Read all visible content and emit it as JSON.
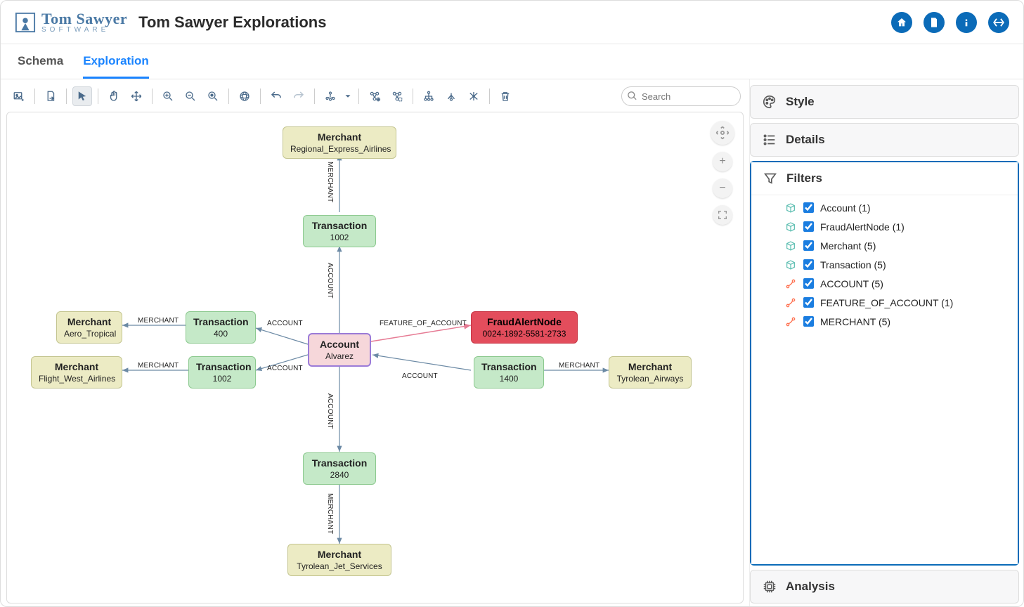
{
  "header": {
    "logo_top": "Tom Sawyer",
    "logo_bottom": "SOFTWARE",
    "app_title": "Tom Sawyer Explorations"
  },
  "tabs": {
    "schema": "Schema",
    "exploration": "Exploration"
  },
  "search": {
    "placeholder": "Search"
  },
  "right_panel": {
    "style": "Style",
    "details": "Details",
    "filters": "Filters",
    "analysis": "Analysis"
  },
  "filters": [
    {
      "label": "Account (1)",
      "kind": "node"
    },
    {
      "label": "FraudAlertNode (1)",
      "kind": "node"
    },
    {
      "label": "Merchant (5)",
      "kind": "node"
    },
    {
      "label": "Transaction (5)",
      "kind": "node"
    },
    {
      "label": "ACCOUNT (5)",
      "kind": "edge"
    },
    {
      "label": "FEATURE_OF_ACCOUNT (1)",
      "kind": "edge"
    },
    {
      "label": "MERCHANT (5)",
      "kind": "edge"
    }
  ],
  "graph": {
    "nodes": {
      "account": {
        "type": "Account",
        "sub": "Alvarez"
      },
      "fraud": {
        "type": "FraudAlertNode",
        "sub": "0024-1892-5581-2733"
      },
      "m_top": {
        "type": "Merchant",
        "sub": "Regional_Express_Airlines"
      },
      "m_left1": {
        "type": "Merchant",
        "sub": "Aero_Tropical"
      },
      "m_left2": {
        "type": "Merchant",
        "sub": "Flight_West_Airlines"
      },
      "m_right": {
        "type": "Merchant",
        "sub": "Tyrolean_Airways"
      },
      "m_bottom": {
        "type": "Merchant",
        "sub": "Tyrolean_Jet_Services"
      },
      "t_top": {
        "type": "Transaction",
        "sub": "1002"
      },
      "t_left1": {
        "type": "Transaction",
        "sub": "400"
      },
      "t_left2": {
        "type": "Transaction",
        "sub": "1002"
      },
      "t_right": {
        "type": "Transaction",
        "sub": "1400"
      },
      "t_bottom": {
        "type": "Transaction",
        "sub": "2840"
      }
    },
    "edge_labels": {
      "merchant": "MERCHANT",
      "account": "ACCOUNT",
      "feature": "FEATURE_OF_ACCOUNT"
    }
  }
}
